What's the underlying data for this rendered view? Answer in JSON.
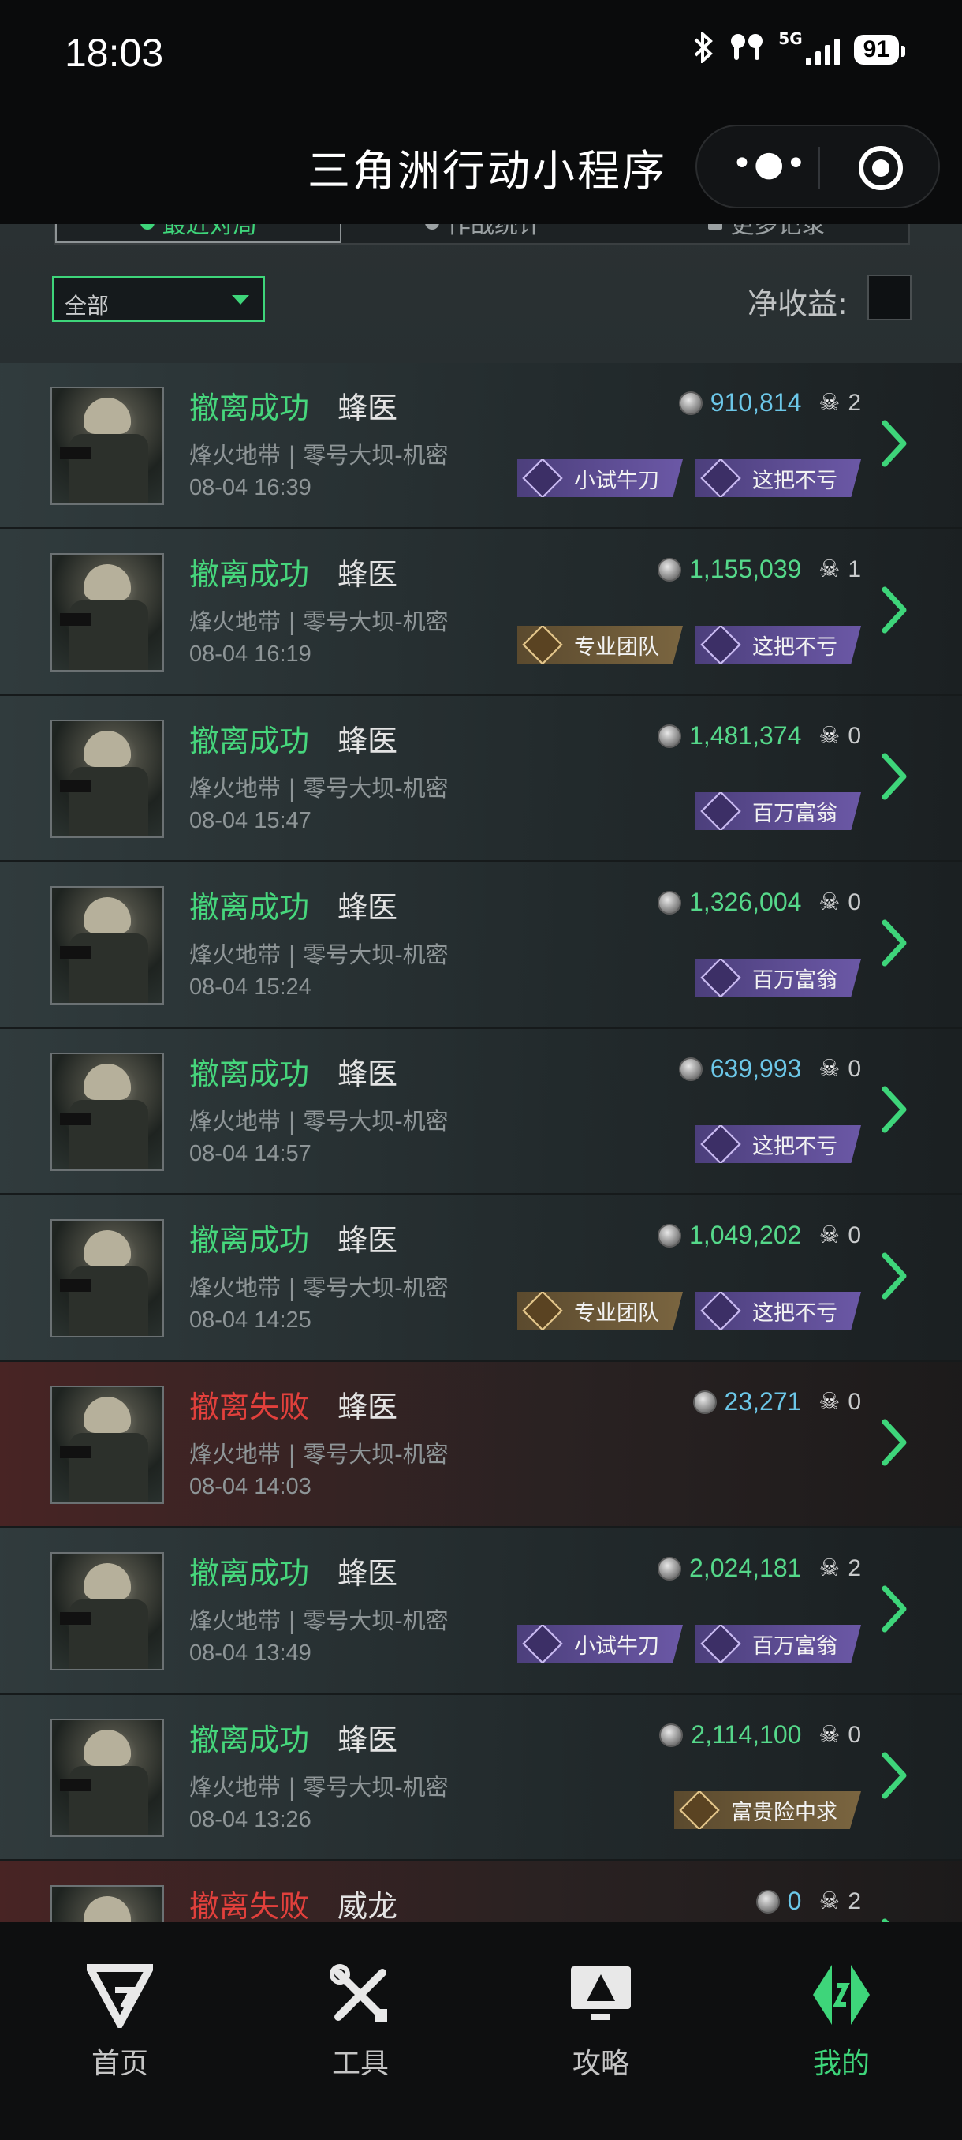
{
  "status_bar": {
    "time": "18:03",
    "network": "5G",
    "battery": "91",
    "icons": [
      "bluetooth-icon",
      "earbuds-icon",
      "signal-icon",
      "battery-icon"
    ]
  },
  "title_bar": {
    "title": "三角洲行动小程序",
    "more_icon": "more-dots-icon",
    "close_icon": "target-close-icon"
  },
  "tabs": [
    {
      "label": "最近对局",
      "active": true
    },
    {
      "label": "作战统计",
      "active": false
    },
    {
      "label": "更多记录",
      "active": false
    }
  ],
  "filter": {
    "selected": "全部",
    "net_label": "净收益:",
    "net_value": ""
  },
  "records": [
    {
      "status": "撤离成功",
      "result": "success",
      "operator": "蜂医",
      "map": "烽火地带 | 零号大坝-机密",
      "time": "08-04 16:39",
      "value": "910,814",
      "value_color": "blue",
      "kills": "2",
      "badges": [
        {
          "label": "小试牛刀",
          "tone": "purple"
        },
        {
          "label": "这把不亏",
          "tone": "purple"
        }
      ]
    },
    {
      "status": "撤离成功",
      "result": "success",
      "operator": "蜂医",
      "map": "烽火地带 | 零号大坝-机密",
      "time": "08-04 16:19",
      "value": "1,155,039",
      "value_color": "green",
      "kills": "1",
      "badges": [
        {
          "label": "专业团队",
          "tone": "gold"
        },
        {
          "label": "这把不亏",
          "tone": "purple"
        }
      ]
    },
    {
      "status": "撤离成功",
      "result": "success",
      "operator": "蜂医",
      "map": "烽火地带 | 零号大坝-机密",
      "time": "08-04 15:47",
      "value": "1,481,374",
      "value_color": "green",
      "kills": "0",
      "badges": [
        {
          "label": "百万富翁",
          "tone": "purple"
        }
      ]
    },
    {
      "status": "撤离成功",
      "result": "success",
      "operator": "蜂医",
      "map": "烽火地带 | 零号大坝-机密",
      "time": "08-04 15:24",
      "value": "1,326,004",
      "value_color": "green",
      "kills": "0",
      "badges": [
        {
          "label": "百万富翁",
          "tone": "purple"
        }
      ]
    },
    {
      "status": "撤离成功",
      "result": "success",
      "operator": "蜂医",
      "map": "烽火地带 | 零号大坝-机密",
      "time": "08-04 14:57",
      "value": "639,993",
      "value_color": "blue",
      "kills": "0",
      "badges": [
        {
          "label": "这把不亏",
          "tone": "purple"
        }
      ]
    },
    {
      "status": "撤离成功",
      "result": "success",
      "operator": "蜂医",
      "map": "烽火地带 | 零号大坝-机密",
      "time": "08-04 14:25",
      "value": "1,049,202",
      "value_color": "green",
      "kills": "0",
      "badges": [
        {
          "label": "专业团队",
          "tone": "gold"
        },
        {
          "label": "这把不亏",
          "tone": "purple"
        }
      ]
    },
    {
      "status": "撤离失败",
      "result": "fail",
      "operator": "蜂医",
      "map": "烽火地带 | 零号大坝-机密",
      "time": "08-04 14:03",
      "value": "23,271",
      "value_color": "blue",
      "kills": "0",
      "badges": []
    },
    {
      "status": "撤离成功",
      "result": "success",
      "operator": "蜂医",
      "map": "烽火地带 | 零号大坝-机密",
      "time": "08-04 13:49",
      "value": "2,024,181",
      "value_color": "green",
      "kills": "2",
      "badges": [
        {
          "label": "小试牛刀",
          "tone": "purple"
        },
        {
          "label": "百万富翁",
          "tone": "purple"
        }
      ]
    },
    {
      "status": "撤离成功",
      "result": "success",
      "operator": "蜂医",
      "map": "烽火地带 | 零号大坝-机密",
      "time": "08-04 13:26",
      "value": "2,114,100",
      "value_color": "green",
      "kills": "0",
      "badges": [
        {
          "label": "富贵险中求",
          "tone": "gold"
        }
      ]
    },
    {
      "status": "撤离失败",
      "result": "fail",
      "operator": "威龙",
      "map": "",
      "time": "",
      "value": "0",
      "value_color": "blue",
      "kills": "2",
      "badges": []
    }
  ],
  "bottom_nav": [
    {
      "label": "首页",
      "icon": "home-logo-icon",
      "active": false
    },
    {
      "label": "工具",
      "icon": "tools-icon",
      "active": false
    },
    {
      "label": "攻略",
      "icon": "guide-monitor-icon",
      "active": false
    },
    {
      "label": "我的",
      "icon": "profile-logo-icon",
      "active": true
    }
  ],
  "colors": {
    "accent_green": "#3ed57a",
    "success_text": "#46d67c",
    "fail_text": "#e2403c",
    "value_blue": "#6cc7e8",
    "badge_purple": "#6b58a6",
    "badge_gold": "#7a6540"
  }
}
